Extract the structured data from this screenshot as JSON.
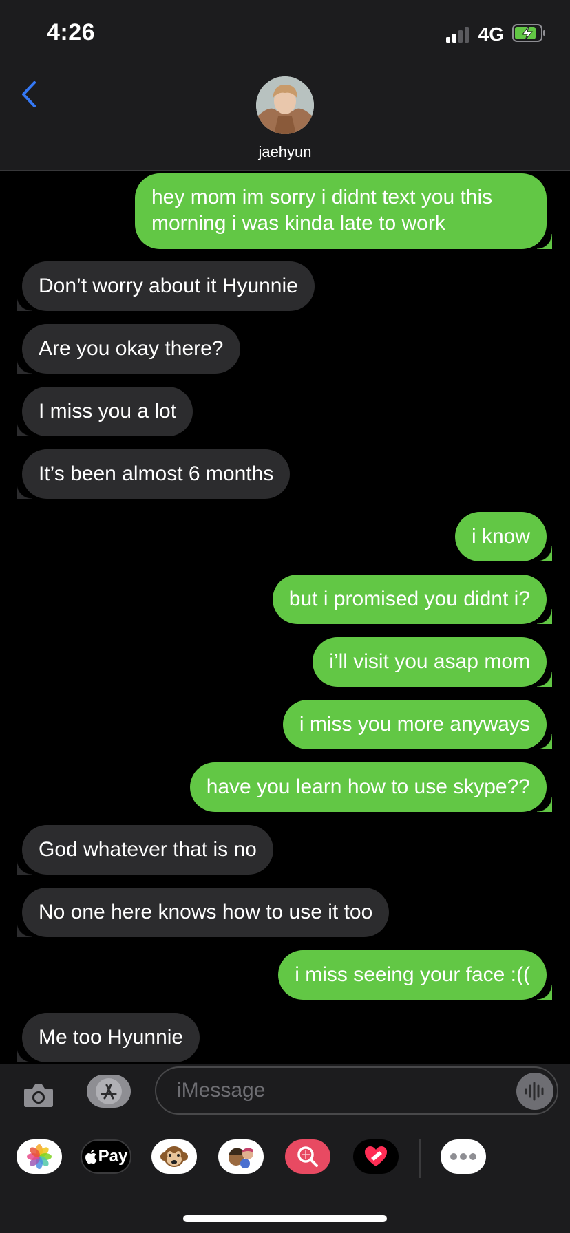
{
  "status_bar": {
    "time": "4:26",
    "network": "4G"
  },
  "header": {
    "back_icon": "chevron-left-icon",
    "contact_name": "jaehyun",
    "accent_color": "#3478f6"
  },
  "messages": [
    {
      "dir": "out",
      "text": "hey mom im sorry i didnt text you this morning i was kinda late to work"
    },
    {
      "dir": "in",
      "text": "Don’t worry about it Hyunnie"
    },
    {
      "dir": "in",
      "text": "Are you okay there?"
    },
    {
      "dir": "in",
      "text": "I miss you a lot"
    },
    {
      "dir": "in",
      "text": "It’s been almost 6 months"
    },
    {
      "dir": "out",
      "text": "i know"
    },
    {
      "dir": "out",
      "text": "but i promised you didnt i?"
    },
    {
      "dir": "out",
      "text": "i’ll visit you asap mom"
    },
    {
      "dir": "out",
      "text": "i miss you more anyways"
    },
    {
      "dir": "out",
      "text": "have you learn how to use skype??"
    },
    {
      "dir": "in",
      "text": "God whatever that is no"
    },
    {
      "dir": "in",
      "text": "No one here knows how to use it too"
    },
    {
      "dir": "out",
      "text": "i miss seeing your face :(("
    },
    {
      "dir": "in",
      "text": "Me too Hyunnie"
    }
  ],
  "composer": {
    "placeholder": "iMessage",
    "camera_icon": "camera-icon",
    "apps_icon": "app-store-icon",
    "audio_icon": "audio-waveform-icon"
  },
  "app_drawer": {
    "apple_pay_label": "Pay",
    "items": [
      "photos-icon",
      "apple-pay-icon",
      "monkey-emoji-icon",
      "memoji-icon",
      "image-search-icon",
      "heart-sticker-icon",
      "more-icon"
    ]
  },
  "colors": {
    "outgoing_bubble": "#62c745",
    "incoming_bubble": "#2c2c2e",
    "background": "#000000"
  }
}
